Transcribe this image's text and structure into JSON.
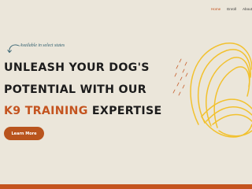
{
  "nav": {
    "items": [
      {
        "label": "Home",
        "active": true
      },
      {
        "label": "Enroll",
        "active": false
      },
      {
        "label": "About",
        "active": false
      }
    ]
  },
  "hero": {
    "note": "Available in select states",
    "line1": "UNLEASH YOUR DOG'S",
    "line2": "POTENTIAL WITH OUR",
    "line3_accent": "K9 TRAINING",
    "line3_rest": " EXPERTISE",
    "cta_label": "Learn More"
  },
  "colors": {
    "background": "#ebe6da",
    "accent": "#c4541f",
    "button": "#b9541d",
    "note": "#2f5e6e",
    "scribble": "#f2c12e",
    "text": "#1c1c1c"
  },
  "icons": [
    "curved-arrow-icon",
    "scribble-decoration-icon"
  ]
}
